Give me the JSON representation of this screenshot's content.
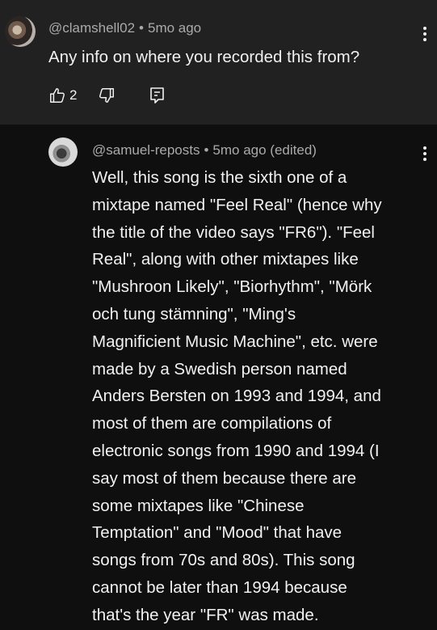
{
  "comments": {
    "top": {
      "author": "@clamshell02",
      "time": "5mo ago",
      "text": "Any info on where you recorded this from?",
      "likes": "2"
    },
    "reply": {
      "author": "@samuel-reposts",
      "time": "5mo ago (edited)",
      "lines": [
        "Well, this song is the sixth one of a",
        "mixtape named \"Feel Real\" (hence why",
        "the title of the video says \"FR6\"). \"Feel",
        "Real\", along with other mixtapes like",
        "\"Mushroon Likely\", \"Biorhythm\", \"Mörk",
        "och tung stämning\", \"Ming's",
        "Magnificient Music Machine\", etc. were",
        "made by a Swedish person named",
        "Anders Bersten on 1993 and 1994, and",
        "most of them are compilations of",
        "electronic songs from 1990 and 1994 (I",
        "say most of them because there are",
        "some mixtapes like \"Chinese",
        "Temptation\" and \"Mood\" that have",
        "songs from 70s and 80s). This song",
        "cannot be later than 1994 because",
        "that's the year \"FR\" was made."
      ]
    }
  },
  "separator": "•",
  "icons": {
    "like": "thumbs-up-icon",
    "dislike": "thumbs-down-icon",
    "reply": "reply-icon",
    "more": "more-vertical-icon"
  },
  "colors": {
    "top_background": "#212121",
    "reply_background": "#0f0f0f",
    "text": "#f1f1f1",
    "meta_text": "#aaaaaa"
  }
}
